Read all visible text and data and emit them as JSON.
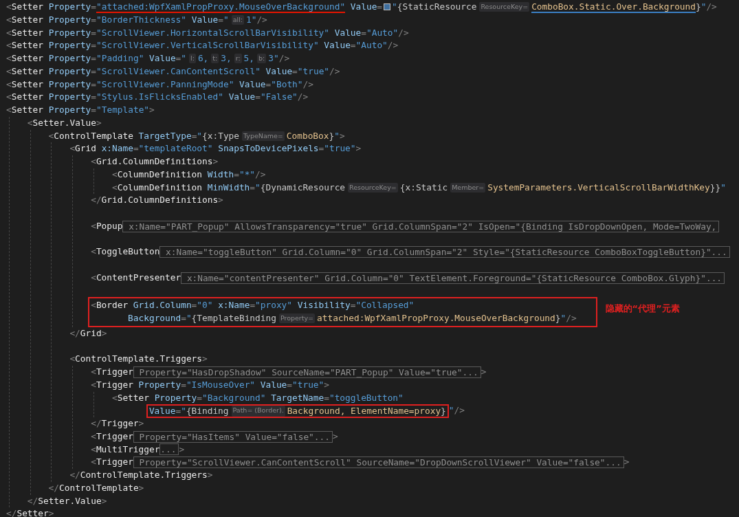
{
  "editor": {
    "lines": [
      {
        "kind": "line",
        "tokens": [
          {
            "kind": "p",
            "text": "<"
          },
          {
            "kind": "tag",
            "text": "Setter"
          },
          {
            "kind": "attr",
            "text": " Property"
          },
          {
            "kind": "p",
            "text": "="
          },
          {
            "kind": "underlined",
            "color": "#e51400",
            "tokens": [
              {
                "kind": "str",
                "text": "\"attached:WpfXamlPropProxy.MouseOverBackground\""
              }
            ]
          },
          {
            "kind": "attr",
            "text": " Value"
          },
          {
            "kind": "p",
            "text": "="
          },
          {
            "kind": "swatch",
            "color": "#3f6f9f"
          },
          {
            "kind": "str",
            "text": "\""
          },
          {
            "kind": "ext",
            "text": "{StaticResource"
          },
          {
            "kind": "hint",
            "text": "ResourceKey="
          },
          {
            "kind": "underlined",
            "color": "#3b7fc4",
            "tokens": [
              {
                "kind": "key",
                "text": "ComboBox.Static.Over.Background"
              }
            ]
          },
          {
            "kind": "ext",
            "text": "}"
          },
          {
            "kind": "str",
            "text": "\""
          },
          {
            "kind": "p",
            "text": "/>"
          }
        ]
      },
      {
        "kind": "line",
        "tokens": [
          {
            "kind": "p",
            "text": "<"
          },
          {
            "kind": "tag",
            "text": "Setter"
          },
          {
            "kind": "attr",
            "text": " Property"
          },
          {
            "kind": "p",
            "text": "="
          },
          {
            "kind": "str",
            "text": "\"BorderThickness\""
          },
          {
            "kind": "attr",
            "text": " Value"
          },
          {
            "kind": "p",
            "text": "="
          },
          {
            "kind": "str",
            "text": "\""
          },
          {
            "kind": "hint",
            "text": "all:"
          },
          {
            "kind": "str",
            "text": "1\""
          },
          {
            "kind": "p",
            "text": "/>"
          }
        ]
      },
      {
        "kind": "line",
        "tokens": [
          {
            "kind": "p",
            "text": "<"
          },
          {
            "kind": "tag",
            "text": "Setter"
          },
          {
            "kind": "attr",
            "text": " Property"
          },
          {
            "kind": "p",
            "text": "="
          },
          {
            "kind": "str",
            "text": "\"ScrollViewer.HorizontalScrollBarVisibility\""
          },
          {
            "kind": "attr",
            "text": " Value"
          },
          {
            "kind": "p",
            "text": "="
          },
          {
            "kind": "str",
            "text": "\"Auto\""
          },
          {
            "kind": "p",
            "text": "/>"
          }
        ]
      },
      {
        "kind": "line",
        "tokens": [
          {
            "kind": "p",
            "text": "<"
          },
          {
            "kind": "tag",
            "text": "Setter"
          },
          {
            "kind": "attr",
            "text": " Property"
          },
          {
            "kind": "p",
            "text": "="
          },
          {
            "kind": "str",
            "text": "\"ScrollViewer.VerticalScrollBarVisibility\""
          },
          {
            "kind": "attr",
            "text": " Value"
          },
          {
            "kind": "p",
            "text": "="
          },
          {
            "kind": "str",
            "text": "\"Auto\""
          },
          {
            "kind": "p",
            "text": "/>"
          }
        ]
      },
      {
        "kind": "line",
        "tokens": [
          {
            "kind": "p",
            "text": "<"
          },
          {
            "kind": "tag",
            "text": "Setter"
          },
          {
            "kind": "attr",
            "text": " Property"
          },
          {
            "kind": "p",
            "text": "="
          },
          {
            "kind": "str",
            "text": "\"Padding\""
          },
          {
            "kind": "attr",
            "text": " Value"
          },
          {
            "kind": "p",
            "text": "="
          },
          {
            "kind": "str",
            "text": "\""
          },
          {
            "kind": "hint",
            "text": "l:"
          },
          {
            "kind": "str",
            "text": "6,"
          },
          {
            "kind": "hint",
            "text": "t:"
          },
          {
            "kind": "str",
            "text": "3,"
          },
          {
            "kind": "hint",
            "text": "r:"
          },
          {
            "kind": "str",
            "text": "5,"
          },
          {
            "kind": "hint",
            "text": "b:"
          },
          {
            "kind": "str",
            "text": "3\""
          },
          {
            "kind": "p",
            "text": "/>"
          }
        ]
      },
      {
        "kind": "line",
        "tokens": [
          {
            "kind": "p",
            "text": "<"
          },
          {
            "kind": "tag",
            "text": "Setter"
          },
          {
            "kind": "attr",
            "text": " Property"
          },
          {
            "kind": "p",
            "text": "="
          },
          {
            "kind": "str",
            "text": "\"ScrollViewer.CanContentScroll\""
          },
          {
            "kind": "attr",
            "text": " Value"
          },
          {
            "kind": "p",
            "text": "="
          },
          {
            "kind": "str",
            "text": "\"true\""
          },
          {
            "kind": "p",
            "text": "/>"
          }
        ]
      },
      {
        "kind": "line",
        "tokens": [
          {
            "kind": "p",
            "text": "<"
          },
          {
            "kind": "tag",
            "text": "Setter"
          },
          {
            "kind": "attr",
            "text": " Property"
          },
          {
            "kind": "p",
            "text": "="
          },
          {
            "kind": "str",
            "text": "\"ScrollViewer.PanningMode\""
          },
          {
            "kind": "attr",
            "text": " Value"
          },
          {
            "kind": "p",
            "text": "="
          },
          {
            "kind": "str",
            "text": "\"Both\""
          },
          {
            "kind": "p",
            "text": "/>"
          }
        ]
      },
      {
        "kind": "line",
        "tokens": [
          {
            "kind": "p",
            "text": "<"
          },
          {
            "kind": "tag",
            "text": "Setter"
          },
          {
            "kind": "attr",
            "text": " Property"
          },
          {
            "kind": "p",
            "text": "="
          },
          {
            "kind": "str",
            "text": "\"Stylus.IsFlicksEnabled\""
          },
          {
            "kind": "attr",
            "text": " Value"
          },
          {
            "kind": "p",
            "text": "="
          },
          {
            "kind": "str",
            "text": "\"False\""
          },
          {
            "kind": "p",
            "text": "/>"
          }
        ]
      },
      {
        "kind": "line",
        "tokens": [
          {
            "kind": "p",
            "text": "<"
          },
          {
            "kind": "tag",
            "text": "Setter"
          },
          {
            "kind": "attr",
            "text": " Property"
          },
          {
            "kind": "p",
            "text": "="
          },
          {
            "kind": "str",
            "text": "\"Template\""
          },
          {
            "kind": "p",
            "text": ">"
          }
        ],
        "children": [
          {
            "kind": "line",
            "tokens": [
              {
                "kind": "p",
                "text": "<"
              },
              {
                "kind": "tag",
                "text": "Setter.Value"
              },
              {
                "kind": "p",
                "text": ">"
              }
            ],
            "children": [
              {
                "kind": "line",
                "tokens": [
                  {
                    "kind": "p",
                    "text": "<"
                  },
                  {
                    "kind": "tag",
                    "text": "ControlTemplate"
                  },
                  {
                    "kind": "attr",
                    "text": " TargetType"
                  },
                  {
                    "kind": "p",
                    "text": "="
                  },
                  {
                    "kind": "str",
                    "text": "\""
                  },
                  {
                    "kind": "ext",
                    "text": "{x:Type"
                  },
                  {
                    "kind": "hint",
                    "text": "TypeName="
                  },
                  {
                    "kind": "key",
                    "text": "ComboBox"
                  },
                  {
                    "kind": "ext",
                    "text": "}"
                  },
                  {
                    "kind": "str",
                    "text": "\""
                  },
                  {
                    "kind": "p",
                    "text": ">"
                  }
                ],
                "children": [
                  {
                    "kind": "line",
                    "tokens": [
                      {
                        "kind": "p",
                        "text": "<"
                      },
                      {
                        "kind": "tag",
                        "text": "Grid"
                      },
                      {
                        "kind": "attr",
                        "text": " x:Name"
                      },
                      {
                        "kind": "p",
                        "text": "="
                      },
                      {
                        "kind": "str",
                        "text": "\"templateRoot\""
                      },
                      {
                        "kind": "attr",
                        "text": " SnapsToDevicePixels"
                      },
                      {
                        "kind": "p",
                        "text": "="
                      },
                      {
                        "kind": "str",
                        "text": "\"true\""
                      },
                      {
                        "kind": "p",
                        "text": ">"
                      }
                    ],
                    "children": [
                      {
                        "kind": "line",
                        "tokens": [
                          {
                            "kind": "p",
                            "text": "<"
                          },
                          {
                            "kind": "tag",
                            "text": "Grid.ColumnDefinitions"
                          },
                          {
                            "kind": "p",
                            "text": ">"
                          }
                        ],
                        "children": [
                          {
                            "kind": "line",
                            "tokens": [
                              {
                                "kind": "p",
                                "text": "<"
                              },
                              {
                                "kind": "tag",
                                "text": "ColumnDefinition"
                              },
                              {
                                "kind": "attr",
                                "text": " Width"
                              },
                              {
                                "kind": "p",
                                "text": "="
                              },
                              {
                                "kind": "str",
                                "text": "\"*\""
                              },
                              {
                                "kind": "p",
                                "text": "/>"
                              }
                            ]
                          },
                          {
                            "kind": "line",
                            "tokens": [
                              {
                                "kind": "p",
                                "text": "<"
                              },
                              {
                                "kind": "tag",
                                "text": "ColumnDefinition"
                              },
                              {
                                "kind": "attr",
                                "text": " MinWidth"
                              },
                              {
                                "kind": "p",
                                "text": "="
                              },
                              {
                                "kind": "str",
                                "text": "\""
                              },
                              {
                                "kind": "ext",
                                "text": "{DynamicResource"
                              },
                              {
                                "kind": "hint",
                                "text": "ResourceKey="
                              },
                              {
                                "kind": "ext",
                                "text": "{x:Static"
                              },
                              {
                                "kind": "hint",
                                "text": "Member="
                              },
                              {
                                "kind": "key",
                                "text": "SystemParameters.VerticalScrollBarWidthKey"
                              },
                              {
                                "kind": "ext",
                                "text": "}}"
                              },
                              {
                                "kind": "str",
                                "text": "\""
                              }
                            ]
                          }
                        ]
                      },
                      {
                        "kind": "line",
                        "tokens": [
                          {
                            "kind": "p",
                            "text": "</"
                          },
                          {
                            "kind": "tag",
                            "text": "Grid.ColumnDefinitions"
                          },
                          {
                            "kind": "p",
                            "text": ">"
                          }
                        ]
                      },
                      {
                        "kind": "blank"
                      },
                      {
                        "kind": "line",
                        "tokens": [
                          {
                            "kind": "p",
                            "text": "<"
                          },
                          {
                            "kind": "tag",
                            "text": "Popup"
                          },
                          {
                            "kind": "fold",
                            "text": " x:Name=\"PART_Popup\" AllowsTransparency=\"true\" Grid.ColumnSpan=\"2\" IsOpen=\"{Binding IsDropDownOpen, Mode=TwoWay,"
                          }
                        ]
                      },
                      {
                        "kind": "blank"
                      },
                      {
                        "kind": "line",
                        "tokens": [
                          {
                            "kind": "p",
                            "text": "<"
                          },
                          {
                            "kind": "tag",
                            "text": "ToggleButton"
                          },
                          {
                            "kind": "fold",
                            "text": " x:Name=\"toggleButton\" Grid.Column=\"0\" Grid.ColumnSpan=\"2\" Style=\"{StaticResource ComboBoxToggleButton}\"..."
                          }
                        ]
                      },
                      {
                        "kind": "blank"
                      },
                      {
                        "kind": "line",
                        "tokens": [
                          {
                            "kind": "p",
                            "text": "<"
                          },
                          {
                            "kind": "tag",
                            "text": "ContentPresenter"
                          },
                          {
                            "kind": "fold",
                            "text": " x:Name=\"contentPresenter\" Grid.Column=\"0\" TextElement.Foreground=\"{StaticResource ComboBox.Glyph}\"..."
                          }
                        ]
                      },
                      {
                        "kind": "blank"
                      },
                      {
                        "kind": "boxed",
                        "note": "隐藏的“代理”元素",
                        "lines": [
                          {
                            "kind": "line",
                            "tokens": [
                              {
                                "kind": "p",
                                "text": "<"
                              },
                              {
                                "kind": "tag",
                                "text": "Border"
                              },
                              {
                                "kind": "attr",
                                "text": " Grid.Column"
                              },
                              {
                                "kind": "p",
                                "text": "="
                              },
                              {
                                "kind": "str",
                                "text": "\"0\""
                              },
                              {
                                "kind": "attr",
                                "text": " x:Name"
                              },
                              {
                                "kind": "p",
                                "text": "="
                              },
                              {
                                "kind": "str",
                                "text": "\"proxy\""
                              },
                              {
                                "kind": "attr",
                                "text": " Visibility"
                              },
                              {
                                "kind": "p",
                                "text": "="
                              },
                              {
                                "kind": "str",
                                "text": "\"Collapsed\""
                              }
                            ]
                          },
                          {
                            "kind": "continuation",
                            "tokens": [
                              {
                                "kind": "attr",
                                "text": "Background"
                              },
                              {
                                "kind": "p",
                                "text": "="
                              },
                              {
                                "kind": "str",
                                "text": "\""
                              },
                              {
                                "kind": "ext",
                                "text": "{TemplateBinding"
                              },
                              {
                                "kind": "hint",
                                "text": "Property="
                              },
                              {
                                "kind": "key",
                                "text": "attached:WpfXamlPropProxy.MouseOverBackground"
                              },
                              {
                                "kind": "ext",
                                "text": "}"
                              },
                              {
                                "kind": "str",
                                "text": "\""
                              },
                              {
                                "kind": "p",
                                "text": "/>"
                              }
                            ]
                          }
                        ]
                      }
                    ]
                  },
                  {
                    "kind": "line",
                    "tokens": [
                      {
                        "kind": "p",
                        "text": "</"
                      },
                      {
                        "kind": "tag",
                        "text": "Grid"
                      },
                      {
                        "kind": "p",
                        "text": ">"
                      }
                    ]
                  },
                  {
                    "kind": "blank"
                  },
                  {
                    "kind": "line",
                    "tokens": [
                      {
                        "kind": "p",
                        "text": "<"
                      },
                      {
                        "kind": "tag",
                        "text": "ControlTemplate.Triggers"
                      },
                      {
                        "kind": "p",
                        "text": ">"
                      }
                    ],
                    "children": [
                      {
                        "kind": "line",
                        "tokens": [
                          {
                            "kind": "p",
                            "text": "<"
                          },
                          {
                            "kind": "tag",
                            "text": "Trigger"
                          },
                          {
                            "kind": "fold",
                            "text": " Property=\"HasDropShadow\" SourceName=\"PART_Popup\" Value=\"true\"..."
                          },
                          {
                            "kind": "p",
                            "text": ">"
                          }
                        ]
                      },
                      {
                        "kind": "line",
                        "tokens": [
                          {
                            "kind": "p",
                            "text": "<"
                          },
                          {
                            "kind": "tag",
                            "text": "Trigger"
                          },
                          {
                            "kind": "attr",
                            "text": " Property"
                          },
                          {
                            "kind": "p",
                            "text": "="
                          },
                          {
                            "kind": "str",
                            "text": "\"IsMouseOver\""
                          },
                          {
                            "kind": "attr",
                            "text": " Value"
                          },
                          {
                            "kind": "p",
                            "text": "="
                          },
                          {
                            "kind": "str",
                            "text": "\"true\""
                          },
                          {
                            "kind": "p",
                            "text": ">"
                          }
                        ],
                        "children": [
                          {
                            "kind": "line",
                            "tokens": [
                              {
                                "kind": "p",
                                "text": "<"
                              },
                              {
                                "kind": "tag",
                                "text": "Setter"
                              },
                              {
                                "kind": "attr",
                                "text": " Property"
                              },
                              {
                                "kind": "p",
                                "text": "="
                              },
                              {
                                "kind": "str",
                                "text": "\"Background\""
                              },
                              {
                                "kind": "attr",
                                "text": " TargetName"
                              },
                              {
                                "kind": "p",
                                "text": "="
                              },
                              {
                                "kind": "str",
                                "text": "\"toggleButton\""
                              }
                            ]
                          },
                          {
                            "kind": "continuation",
                            "tokens": [
                              {
                                "kind": "boxed",
                                "tokens": [
                                  {
                                    "kind": "attr",
                                    "text": "Value"
                                  },
                                  {
                                    "kind": "p",
                                    "text": "="
                                  },
                                  {
                                    "kind": "str",
                                    "text": "\""
                                  },
                                  {
                                    "kind": "ext",
                                    "text": "{Binding"
                                  },
                                  {
                                    "kind": "hint",
                                    "text": "Path= (Border)."
                                  },
                                  {
                                    "kind": "key",
                                    "text": "Background, ElementName=proxy"
                                  },
                                  {
                                    "kind": "ext",
                                    "text": "}"
                                  }
                                ]
                              },
                              {
                                "kind": "str",
                                "text": "\""
                              },
                              {
                                "kind": "p",
                                "text": "/>"
                              }
                            ]
                          }
                        ]
                      },
                      {
                        "kind": "line",
                        "tokens": [
                          {
                            "kind": "p",
                            "text": "</"
                          },
                          {
                            "kind": "tag",
                            "text": "Trigger"
                          },
                          {
                            "kind": "p",
                            "text": ">"
                          }
                        ]
                      },
                      {
                        "kind": "line",
                        "tokens": [
                          {
                            "kind": "p",
                            "text": "<"
                          },
                          {
                            "kind": "tag",
                            "text": "Trigger"
                          },
                          {
                            "kind": "fold",
                            "text": " Property=\"HasItems\" Value=\"false\"..."
                          },
                          {
                            "kind": "p",
                            "text": ">"
                          }
                        ]
                      },
                      {
                        "kind": "line",
                        "tokens": [
                          {
                            "kind": "p",
                            "text": "<"
                          },
                          {
                            "kind": "tag",
                            "text": "MultiTrigger"
                          },
                          {
                            "kind": "fold",
                            "text": "..."
                          },
                          {
                            "kind": "p",
                            "text": ">"
                          }
                        ]
                      },
                      {
                        "kind": "line",
                        "tokens": [
                          {
                            "kind": "p",
                            "text": "<"
                          },
                          {
                            "kind": "tag",
                            "text": "Trigger"
                          },
                          {
                            "kind": "fold",
                            "text": " Property=\"ScrollViewer.CanContentScroll\" SourceName=\"DropDownScrollViewer\" Value=\"false\"..."
                          },
                          {
                            "kind": "p",
                            "text": ">"
                          }
                        ]
                      }
                    ]
                  },
                  {
                    "kind": "line",
                    "tokens": [
                      {
                        "kind": "p",
                        "text": "</"
                      },
                      {
                        "kind": "tag",
                        "text": "ControlTemplate.Triggers"
                      },
                      {
                        "kind": "p",
                        "text": ">"
                      }
                    ]
                  }
                ]
              },
              {
                "kind": "line",
                "tokens": [
                  {
                    "kind": "p",
                    "text": "</"
                  },
                  {
                    "kind": "tag",
                    "text": "ControlTemplate"
                  },
                  {
                    "kind": "p",
                    "text": ">"
                  }
                ]
              }
            ]
          },
          {
            "kind": "line",
            "tokens": [
              {
                "kind": "p",
                "text": "</"
              },
              {
                "kind": "tag",
                "text": "Setter.Value"
              },
              {
                "kind": "p",
                "text": ">"
              }
            ]
          }
        ]
      },
      {
        "kind": "line",
        "tokens": [
          {
            "kind": "p",
            "text": "</"
          },
          {
            "kind": "tag",
            "text": "Setter"
          },
          {
            "kind": "p",
            "text": ">"
          }
        ]
      }
    ]
  }
}
